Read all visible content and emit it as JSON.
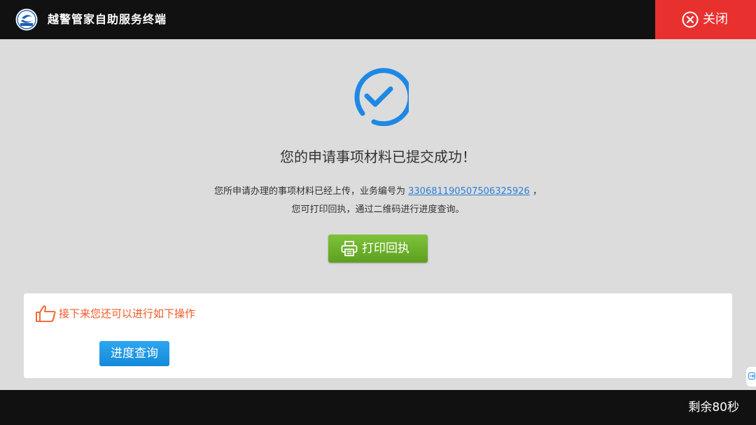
{
  "header": {
    "app_title": "越警管家自助服务终端",
    "close_label": "关闭"
  },
  "main": {
    "headline": "您的申请事项材料已提交成功！",
    "desc_prefix": "您所申请办理的事项材料已经上传，业务编号为",
    "business_number": "330681190507506325926",
    "desc_suffix": "，",
    "desc_line2": "您可打印回执，通过二维码进行进度查询。",
    "print_button_label": "打印回执"
  },
  "next_steps": {
    "title": "接下来您还可以进行如下操作",
    "progress_button_label": "进度查询"
  },
  "footer": {
    "countdown": "剩余80秒"
  },
  "icons": {
    "logo": "police-logo-icon",
    "close": "close-circle-icon",
    "success": "check-circle-icon",
    "print": "printer-icon",
    "thumb": "thumbs-up-icon"
  },
  "colors": {
    "close_bg": "#e8312f",
    "success_blue": "#1e88e5",
    "link_blue": "#2a7fd8",
    "print_green": "#6cb02b",
    "next_orange": "#f15a24",
    "progress_blue": "#1a95e0"
  }
}
